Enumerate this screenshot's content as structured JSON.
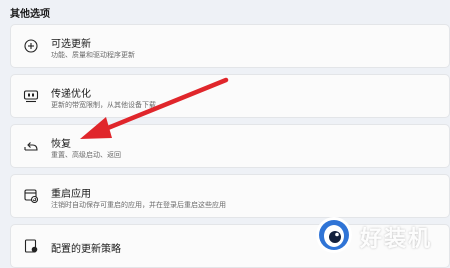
{
  "section": {
    "title": "其他选项"
  },
  "items": [
    {
      "title": "可选更新",
      "subtitle": "功能、质量和驱动程序更新",
      "icon": "plus-circle-icon"
    },
    {
      "title": "传递优化",
      "subtitle": "更新的带宽限制，从其他设备下载",
      "icon": "delivery-optimization-icon"
    },
    {
      "title": "恢复",
      "subtitle": "重置、高级启动、返回",
      "icon": "recovery-icon"
    },
    {
      "title": "重启应用",
      "subtitle": "注销时自动保存可重启的应用，并在登录后重启这些应用",
      "icon": "restart-apps-icon"
    },
    {
      "title": "配置的更新策略",
      "subtitle": "",
      "icon": "policy-icon"
    }
  ],
  "annotation": {
    "arrow_color": "#e0262b"
  },
  "watermark": {
    "text": "好装机",
    "logo": "eye-logo-icon"
  }
}
